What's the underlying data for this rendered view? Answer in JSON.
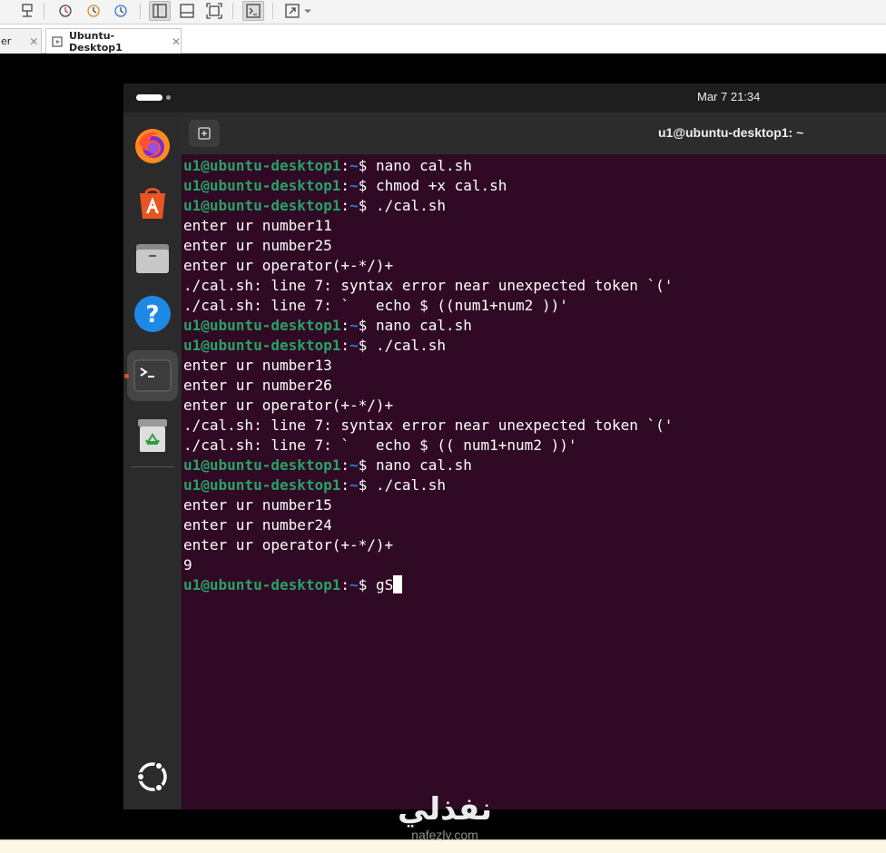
{
  "host": {
    "tabs": [
      {
        "label": "er"
      },
      {
        "label": "Ubuntu-Desktop1"
      }
    ],
    "tab_close": "✕"
  },
  "guest": {
    "clock": "Mar 7  21:34",
    "dock": {
      "items": [
        {
          "name": "Firefox"
        },
        {
          "name": "App Center"
        },
        {
          "name": "Files"
        },
        {
          "name": "Help"
        },
        {
          "name": "Terminal",
          "running": true
        },
        {
          "name": "Trash"
        },
        {
          "name": "Show Apps"
        }
      ]
    },
    "terminal": {
      "title": "u1@ubuntu-desktop1: ~",
      "prompt": {
        "user": "u1@ubuntu-desktop1",
        "sep": ":",
        "path": "~",
        "symbol": "$ "
      },
      "lines": [
        {
          "type": "prompt",
          "cmd": "nano cal.sh"
        },
        {
          "type": "prompt",
          "cmd": "chmod +x cal.sh"
        },
        {
          "type": "prompt",
          "cmd": "./cal.sh"
        },
        {
          "type": "output",
          "text": "enter ur number11"
        },
        {
          "type": "output",
          "text": "enter ur number25"
        },
        {
          "type": "output",
          "text": "enter ur operator(+-*/)+"
        },
        {
          "type": "output",
          "text": "./cal.sh: line 7: syntax error near unexpected token `('"
        },
        {
          "type": "output",
          "text": "./cal.sh: line 7: `   echo $ ((num1+num2 ))'"
        },
        {
          "type": "prompt",
          "cmd": "nano cal.sh"
        },
        {
          "type": "prompt",
          "cmd": "./cal.sh"
        },
        {
          "type": "output",
          "text": "enter ur number13"
        },
        {
          "type": "output",
          "text": "enter ur number26"
        },
        {
          "type": "output",
          "text": "enter ur operator(+-*/)+"
        },
        {
          "type": "output",
          "text": "./cal.sh: line 7: syntax error near unexpected token `('"
        },
        {
          "type": "output",
          "text": "./cal.sh: line 7: `   echo $ (( num1+num2 ))'"
        },
        {
          "type": "prompt",
          "cmd": "nano cal.sh"
        },
        {
          "type": "prompt",
          "cmd": "./cal.sh"
        },
        {
          "type": "output",
          "text": "enter ur number15"
        },
        {
          "type": "output",
          "text": "enter ur number24"
        },
        {
          "type": "output",
          "text": "enter ur operator(+-*/)+"
        },
        {
          "type": "output",
          "text": "9"
        },
        {
          "type": "prompt",
          "cmd": "gS",
          "cursor": true
        }
      ]
    }
  },
  "watermark": {
    "arabic": "نفذلي",
    "latin": "nafezly.com"
  },
  "colors": {
    "terminal_bg": "#300a24",
    "prompt_user": "#26a269",
    "prompt_path": "#2a7bde",
    "accent": "#e95420"
  }
}
